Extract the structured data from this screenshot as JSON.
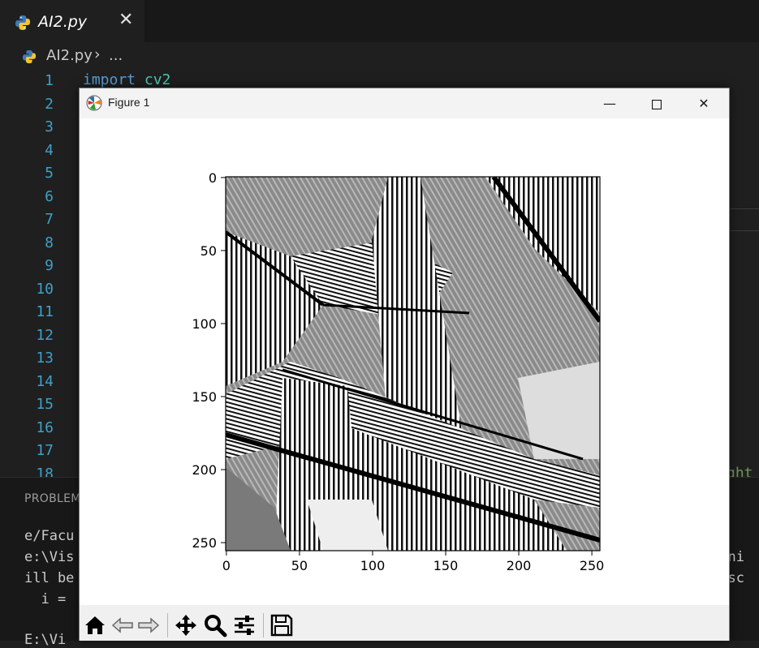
{
  "editor": {
    "tab_name": "AI2.py",
    "tab_close": "✕",
    "breadcrumb_file": "AI2.py",
    "breadcrumb_sep": "›",
    "breadcrumb_more": "...",
    "line_numbers": [
      "1",
      "2",
      "3",
      "4",
      "5",
      "6",
      "7",
      "8",
      "9",
      "10",
      "11",
      "12",
      "13",
      "14",
      "15",
      "16",
      "17",
      "18"
    ],
    "code_line1_kw": "import",
    "code_line1_mod": "cv2",
    "partial_hint": "ght"
  },
  "panel": {
    "tab_label": "PROBLEM",
    "term_lines": [
      "e/Facu",
      "e:\\Vis",
      "ill be",
      "  i =",
      "",
      "E:\\Vi"
    ],
    "term_right": [
      "",
      "arni",
      "e sc",
      "",
      "",
      ""
    ]
  },
  "figure": {
    "title": "Figure 1",
    "controls": {
      "minimize": "—",
      "maximize": "☐",
      "close": "✕"
    },
    "toolbar": [
      "home-icon",
      "back-icon",
      "forward-icon",
      "pan-icon",
      "zoom-icon",
      "configure-subplots-icon",
      "save-icon"
    ]
  },
  "chart_data": {
    "type": "heatmap",
    "description_note": "",
    "x_ticks": [
      "0",
      "50",
      "100",
      "150",
      "200",
      "250"
    ],
    "y_ticks": [
      "0",
      "50",
      "100",
      "150",
      "200",
      "250"
    ],
    "xlim": [
      0,
      256
    ],
    "ylim": [
      256,
      0
    ],
    "colormap": "gray"
  }
}
